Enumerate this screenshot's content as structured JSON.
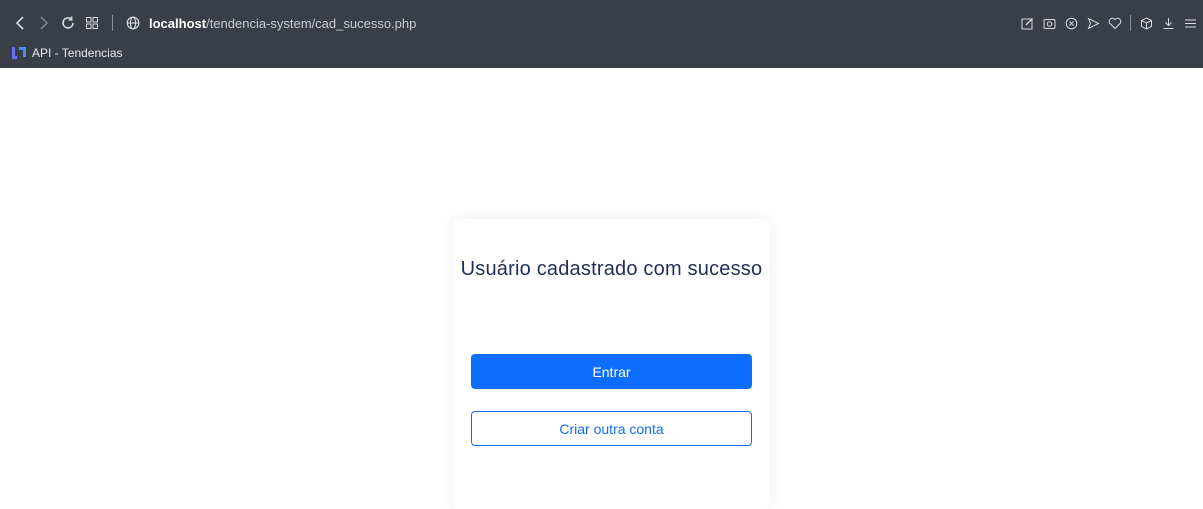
{
  "browser": {
    "nav_icons": [
      "back-icon",
      "forward-icon",
      "reload-icon",
      "grid-icon"
    ],
    "url_host": "localhost",
    "url_path": "/tendencia-system/cad_sucesso.php",
    "right_icons": [
      "edit-icon",
      "camera-icon",
      "close-circle-icon",
      "send-icon",
      "heart-icon",
      "cube-icon",
      "download-icon",
      "menu-icon"
    ],
    "bookmark_label": "API - Tendencias"
  },
  "page": {
    "title": "Usuário cadastrado com sucesso",
    "login_button": "Entrar",
    "create_account_button": "Criar outra conta"
  },
  "colors": {
    "chrome": "#3a3f47",
    "primary": "#0d6efd",
    "title": "#1e2f5a"
  }
}
